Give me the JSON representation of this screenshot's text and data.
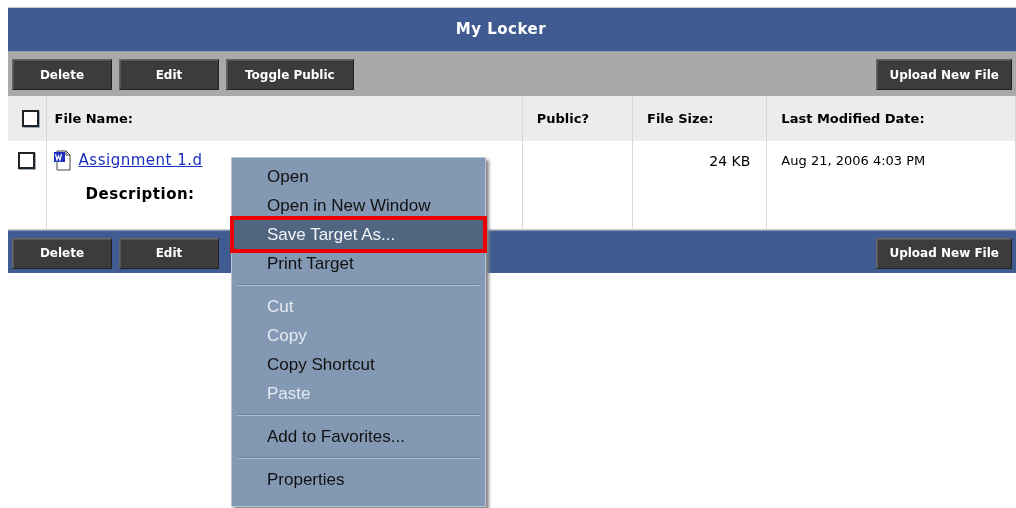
{
  "panel": {
    "title": "My Locker"
  },
  "top_toolbar": {
    "left_buttons": [
      "Delete",
      "Edit",
      "Toggle Public"
    ],
    "right_buttons": [
      "Upload New File"
    ]
  },
  "table": {
    "select_all": {
      "checked": false
    },
    "columns": [
      "File Name:",
      "Public?",
      "File Size:",
      "Last Modified Date:"
    ],
    "rows": [
      {
        "checked": false,
        "file_name": "Assignment 1.d",
        "description_label": "Description:",
        "public": "",
        "size": "24 KB",
        "modified": "Aug 21, 2006 4:03 PM"
      }
    ]
  },
  "bottom_toolbar": {
    "left_buttons": [
      "Delete",
      "Edit"
    ],
    "right_buttons": [
      "Upload New File"
    ]
  },
  "context_menu": {
    "items": [
      {
        "kind": "item",
        "label": "Open",
        "disabled": false,
        "selected": false,
        "marked": false
      },
      {
        "kind": "item",
        "label": "Open in New Window",
        "disabled": false,
        "selected": false,
        "marked": false
      },
      {
        "kind": "item",
        "label": "Save Target As...",
        "disabled": false,
        "selected": true,
        "marked": true
      },
      {
        "kind": "item",
        "label": "Print Target",
        "disabled": false,
        "selected": false,
        "marked": false
      },
      {
        "kind": "separator"
      },
      {
        "kind": "item",
        "label": "Cut",
        "disabled": true,
        "selected": false,
        "marked": false
      },
      {
        "kind": "item",
        "label": "Copy",
        "disabled": true,
        "selected": false,
        "marked": false
      },
      {
        "kind": "item",
        "label": "Copy Shortcut",
        "disabled": false,
        "selected": false,
        "marked": false
      },
      {
        "kind": "item",
        "label": "Paste",
        "disabled": true,
        "selected": false,
        "marked": false
      },
      {
        "kind": "separator"
      },
      {
        "kind": "item",
        "label": "Add to Favorites...",
        "disabled": false,
        "selected": false,
        "marked": false
      },
      {
        "kind": "separator"
      },
      {
        "kind": "item",
        "label": "Properties",
        "disabled": false,
        "selected": false,
        "marked": false
      }
    ]
  }
}
